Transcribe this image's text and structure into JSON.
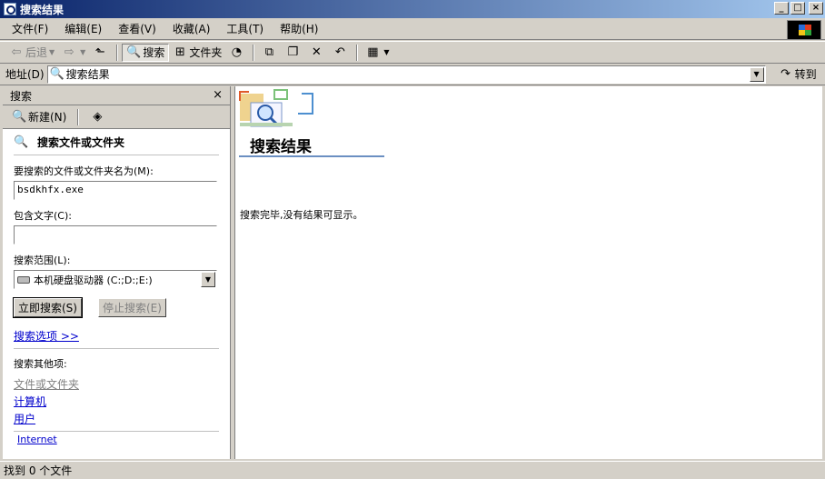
{
  "window": {
    "title": "搜索结果",
    "minimize": "_",
    "maximize": "□",
    "close": "×"
  },
  "menubar": {
    "items": [
      "文件(F)",
      "编辑(E)",
      "查看(V)",
      "收藏(A)",
      "工具(T)",
      "帮助(H)"
    ]
  },
  "toolbar": {
    "back_label": "后退",
    "search_label": "搜索",
    "folders_label": "文件夹"
  },
  "address": {
    "label": "地址(D)",
    "value": "搜索结果",
    "go_label": "转到"
  },
  "search_pane": {
    "title": "搜索",
    "close": "×",
    "new_label": "新建(N)",
    "section_title": "搜索文件或文件夹",
    "name_label": "要搜索的文件或文件夹名为(M):",
    "name_value": "bsdkhfx.exe",
    "contains_label": "包含文字(C):",
    "contains_value": "",
    "lookin_label": "搜索范围(L):",
    "lookin_value": "本机硬盘驱动器 (C:;D:;E:)",
    "search_now": "立即搜索(S)",
    "stop_search": "停止搜索(E)",
    "options_link": "搜索选项 >>",
    "other_label": "搜索其他项:",
    "other_items": [
      "文件或文件夹",
      "计算机",
      "用户"
    ],
    "internet_link": "Internet"
  },
  "results": {
    "title": "搜索结果",
    "message": "搜索完毕,没有结果可显示。"
  },
  "status": {
    "text": "找到 0 个文件"
  },
  "colors": {
    "titlebar_start": "#0a246a",
    "titlebar_end": "#a6caf0",
    "chrome": "#d4d0c8",
    "link": "#0000cc",
    "rule": "#6b8fc2"
  }
}
